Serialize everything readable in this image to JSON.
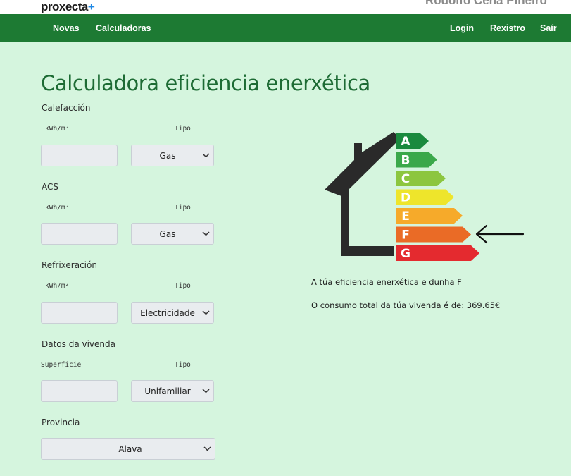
{
  "header": {
    "logo_text": "proxecta",
    "logo_plus": "+",
    "username": "Rodolfo Ceña Piñeiro"
  },
  "nav": {
    "left": [
      "Novas",
      "Calculadoras"
    ],
    "right": [
      "Login",
      "Rexistro",
      "Saír"
    ]
  },
  "title": "Calculadora eficiencia enerxética",
  "form": {
    "calefaccion": {
      "label": "Calefacción",
      "value_label": "kWh/m²",
      "type_label": "Tipo",
      "value": "",
      "type": "Gas"
    },
    "acs": {
      "label": "ACS",
      "value_label": "kWh/m²",
      "type_label": "Tipo",
      "value": "",
      "type": "Gas"
    },
    "refrixeracion": {
      "label": "Refrixeración",
      "value_label": "kWh/m²",
      "type_label": "Tipo",
      "value": "",
      "type": "Electricidade"
    },
    "vivenda": {
      "label": "Datos da vivenda",
      "value_label": "Superficie",
      "type_label": "Tipo",
      "value": "",
      "type": "Unifamiliar"
    },
    "provincia": {
      "label": "Provincia",
      "value": "Alava"
    }
  },
  "rating": {
    "letters": [
      "A",
      "B",
      "C",
      "D",
      "E",
      "F",
      "G"
    ],
    "colors": [
      "#1a8a3e",
      "#3aa84a",
      "#8cc63f",
      "#eee52b",
      "#f6aa2a",
      "#ea6b26",
      "#e42a2f"
    ],
    "selected": "F",
    "house_color": "#2a2a2a",
    "arrow_color": "#111111"
  },
  "result": {
    "efficiency_text": "A túa eficiencia enerxética e dunha F",
    "consumption_text": "O consumo total da túa vivenda é de: 369.65€"
  }
}
